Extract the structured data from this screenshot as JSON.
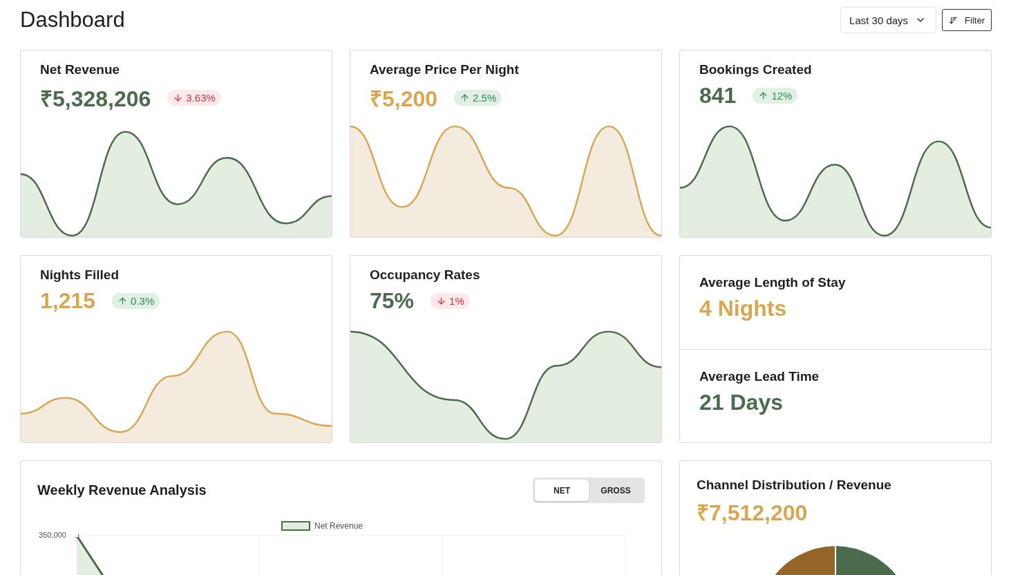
{
  "title": "Dashboard",
  "controls": {
    "range": {
      "label": "Last 30 days"
    },
    "filter": {
      "label": "Filter"
    }
  },
  "metrics": [
    {
      "title": "Net Revenue",
      "value": "₹5,328,206",
      "color": "#4a6b4c",
      "trend": {
        "kind": "down",
        "text": "3.63%"
      }
    },
    {
      "title": "Average Price Per Night",
      "value": "₹5,200",
      "color": "#d8a650",
      "trend": {
        "kind": "up",
        "text": "2.5%"
      }
    },
    {
      "title": "Bookings Created",
      "value": "841",
      "color": "#4a6b4c",
      "trend": {
        "kind": "up",
        "text": "12%"
      }
    },
    {
      "title": "Nights Filled",
      "value": "1,215",
      "color": "#d8a650",
      "trend": {
        "kind": "up",
        "text": "0.3%"
      }
    },
    {
      "title": "Occupancy Rates",
      "value": "75%",
      "color": "#4a6b4c",
      "trend": {
        "kind": "down",
        "text": "1%"
      }
    }
  ],
  "stats": [
    {
      "title": "Average Length of Stay",
      "value": "4 Nights",
      "color": "#d8a650"
    },
    {
      "title": "Average Lead Time",
      "value": "21 Days",
      "color": "#4a6b4c"
    }
  ],
  "weekly": {
    "title": "Weekly Revenue Analysis",
    "options": [
      {
        "label": "NET",
        "selected": true
      },
      {
        "label": "GROSS",
        "selected": false
      }
    ],
    "legend": "Net Revenue",
    "y_tick": "350,000"
  },
  "channels": {
    "title": "Channel Distribution / Revenue",
    "value": "₹7,512,200"
  }
}
